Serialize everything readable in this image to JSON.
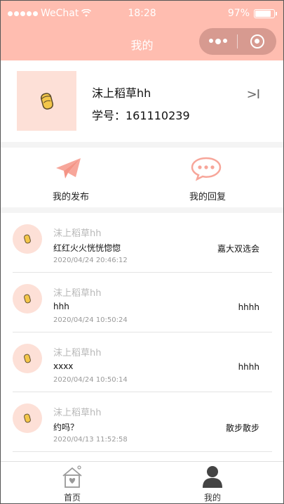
{
  "status_bar": {
    "carrier": "WeChat",
    "time": "18:28",
    "battery": "97%"
  },
  "nav": {
    "title": "我的",
    "more_icon": "more-dots-icon",
    "close_icon": "close-circle-icon"
  },
  "profile": {
    "name": "沫上稻草hh",
    "student_id": "学号：161110239",
    "arrow_text": ">I"
  },
  "actions": [
    {
      "label": "我的发布",
      "icon": "paper-plane-icon"
    },
    {
      "label": "我的回复",
      "icon": "chat-bubble-icon"
    }
  ],
  "list": [
    {
      "user": "沫上稻草hh",
      "text": "红红火火恍恍惚惚",
      "time": "2020/04/24 20:46:12",
      "reply": "嘉大双选会"
    },
    {
      "user": "沫上稻草hh",
      "text": "hhh",
      "time": "2020/04/24 10:50:24",
      "reply": "hhhh"
    },
    {
      "user": "沫上稻草hh",
      "text": "xxxx",
      "time": "2020/04/24 10:50:14",
      "reply": "hhhh"
    },
    {
      "user": "沫上稻草hh",
      "text": "约吗？",
      "time": "2020/04/13 11:52:58",
      "reply": "散步散步"
    }
  ],
  "tabs": [
    {
      "label": "首页",
      "icon": "home-icon"
    },
    {
      "label": "我的",
      "icon": "user-icon"
    }
  ],
  "colors": {
    "accent": "#ffbdb0",
    "avatar_bg": "#fde0d7",
    "icon_pink": "#f7a69a"
  }
}
